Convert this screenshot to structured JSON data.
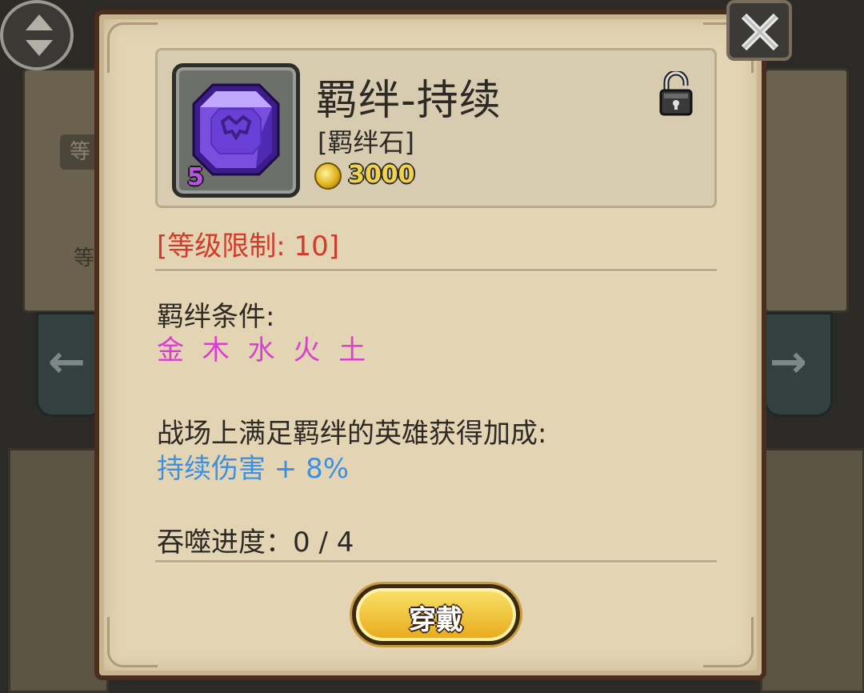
{
  "background": {
    "tag_left": "等",
    "tag_left_2": "等"
  },
  "item": {
    "name": "羁绊-持续",
    "type": "[羁绊石]",
    "level": "5",
    "price": "3000",
    "icon": "purple-gem-icon",
    "locked": false
  },
  "level_limit": "[等级限制: 10]",
  "bond": {
    "condition_label": "羁绊条件:",
    "elements": "金 木 水 火 土"
  },
  "bonus": {
    "description": "战场上满足羁绊的英雄获得加成:",
    "value": "持续伤害 + 8%"
  },
  "devour_progress": "吞噬进度：0 / 4",
  "equip_button": "穿戴",
  "colors": {
    "level_limit": "#d33a2a",
    "elements": "#d93fd0",
    "bonus_value": "#3d8fe2",
    "gem": "#7a4fe0",
    "button": "#f2c634"
  }
}
